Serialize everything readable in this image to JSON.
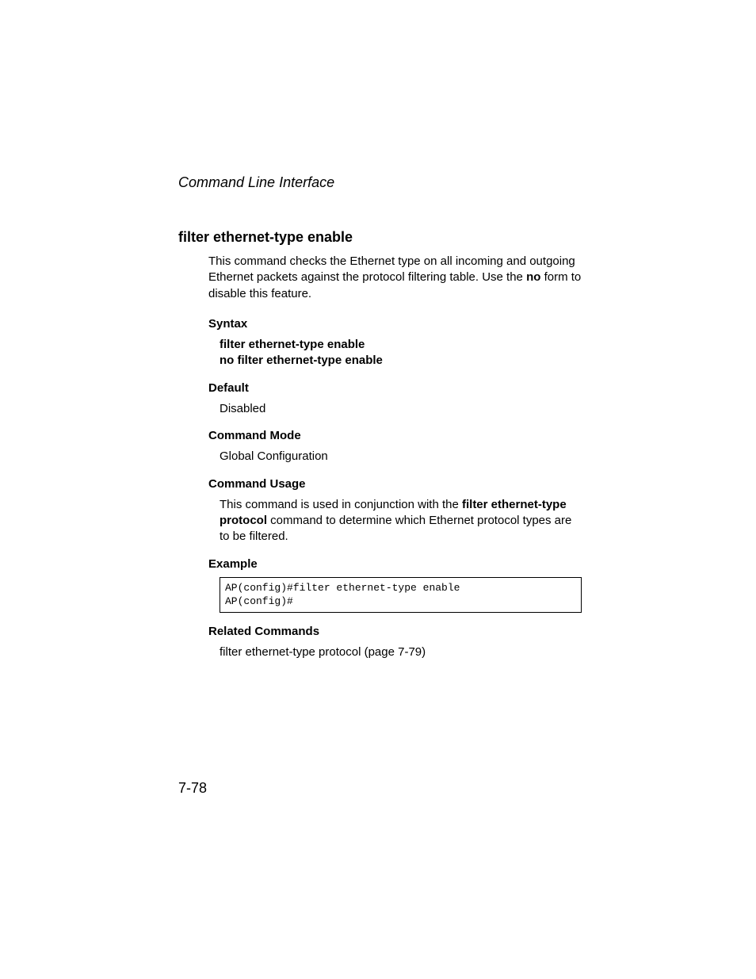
{
  "header": {
    "running": "Command Line Interface"
  },
  "section": {
    "title": "filter ethernet-type enable",
    "intro_pre": "This command checks the Ethernet type on all incoming and outgoing Ethernet packets against the protocol filtering table. Use the ",
    "intro_bold": "no",
    "intro_post": " form to disable this feature."
  },
  "syntax": {
    "heading": "Syntax",
    "line1": "filter ethernet-type enable",
    "line2": "no filter ethernet-type enable"
  },
  "default": {
    "heading": "Default",
    "value": "Disabled"
  },
  "mode": {
    "heading": "Command Mode",
    "value": "Global Configuration"
  },
  "usage": {
    "heading": "Command Usage",
    "pre": "This command is used in conjunction with the ",
    "bold": "filter ethernet-type protocol",
    "post": " command to determine which Ethernet protocol types are to be filtered."
  },
  "example": {
    "heading": "Example",
    "code": "AP(config)#filter ethernet-type enable\nAP(config)#"
  },
  "related": {
    "heading": "Related Commands",
    "value": "filter ethernet-type protocol (page 7-79)"
  },
  "page_number": "7-78"
}
